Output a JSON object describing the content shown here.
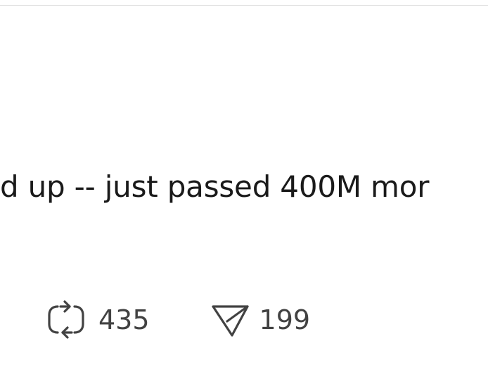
{
  "post": {
    "text": "d up -- just passed 400M mor"
  },
  "actions": {
    "repost": {
      "icon": "repost-icon",
      "count": "435"
    },
    "share": {
      "icon": "send-icon",
      "count": "199"
    }
  },
  "colors": {
    "text": "#1a1a1a",
    "icon": "#424242",
    "divider": "#dcdcdc",
    "background": "#ffffff"
  }
}
